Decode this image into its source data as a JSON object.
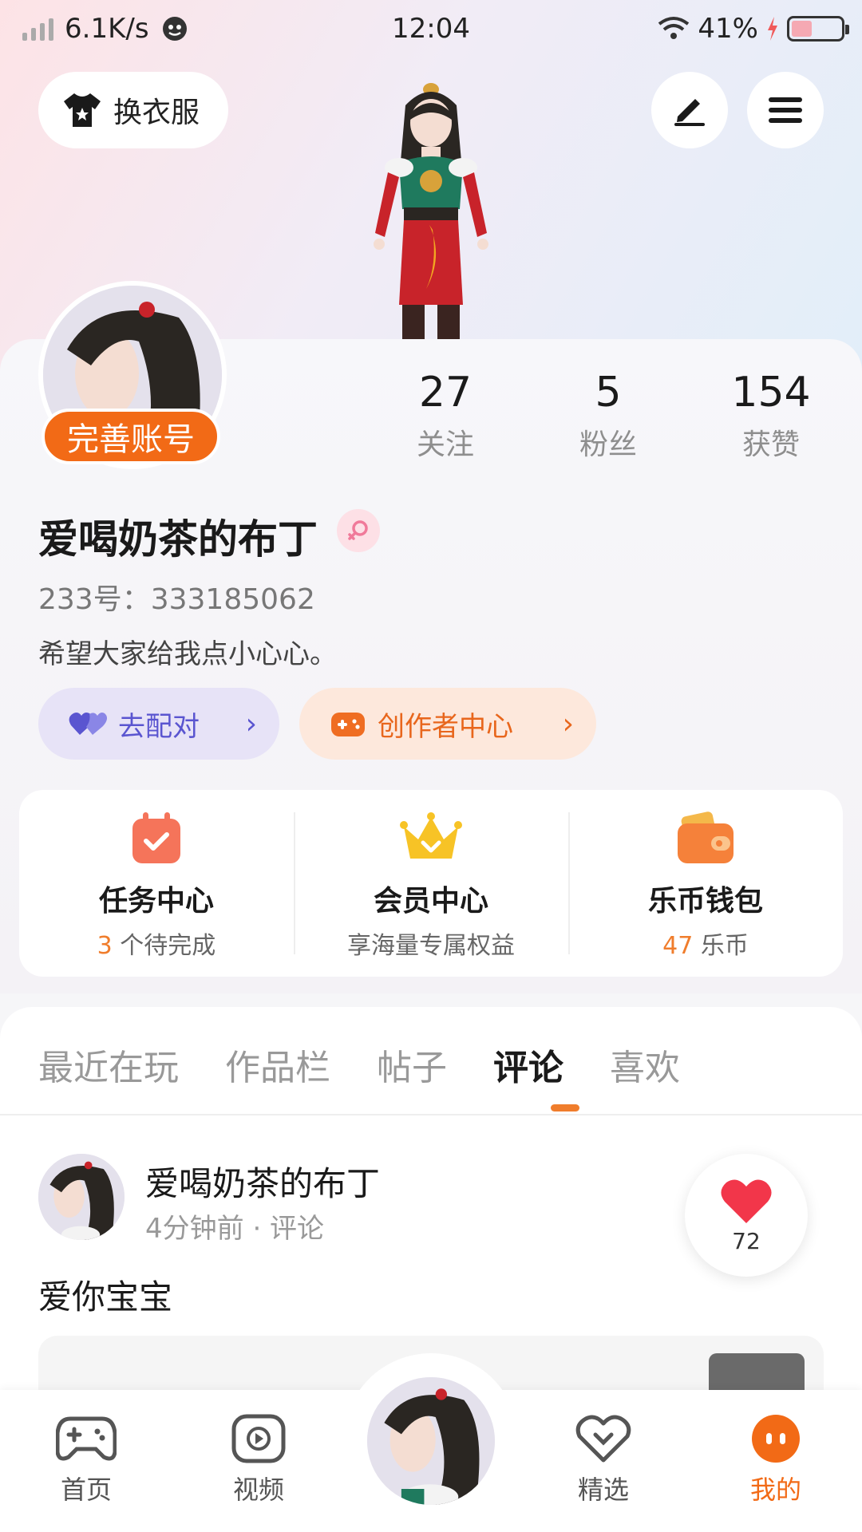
{
  "status_bar": {
    "speed": "6.1K/s",
    "time": "12:04",
    "battery": "41%",
    "battery_level": 0.41
  },
  "header": {
    "change_clothes_label": "换衣服"
  },
  "profile": {
    "complete_account_label": "完善账号",
    "stats": [
      {
        "value": "27",
        "label": "关注"
      },
      {
        "value": "5",
        "label": "粉丝"
      },
      {
        "value": "154",
        "label": "获赞"
      }
    ],
    "nickname": "爱喝奶茶的布丁",
    "uid": "233号：333185062",
    "bio": "希望大家给我点小心心。",
    "chips": {
      "pair_label": "去配对",
      "creator_label": "创作者中心",
      "arrow": "›"
    }
  },
  "services": [
    {
      "title": "任务中心",
      "highlight": "3",
      "sub": " 个待完成"
    },
    {
      "title": "会员中心",
      "highlight": "",
      "sub": "享海量专属权益"
    },
    {
      "title": "乐币钱包",
      "highlight": "47",
      "sub": " 乐币"
    }
  ],
  "tabs": [
    "最近在玩",
    "作品栏",
    "帖子",
    "评论",
    "喜欢"
  ],
  "active_tab_index": 3,
  "post": {
    "author": "爱喝奶茶的布丁",
    "meta": "4分钟前 · 评论",
    "likes": "72",
    "text": "爱你宝宝"
  },
  "bottom_nav": [
    {
      "label": "首页",
      "icon": "gamepad-icon"
    },
    {
      "label": "视频",
      "icon": "video-icon"
    },
    {
      "label": "精选",
      "icon": "heart-badge-icon"
    },
    {
      "label": "我的",
      "icon": "face-icon"
    }
  ],
  "colors": {
    "accent": "#f26a16",
    "pair": "#5a55d0",
    "highlight": "#f07d2c"
  }
}
